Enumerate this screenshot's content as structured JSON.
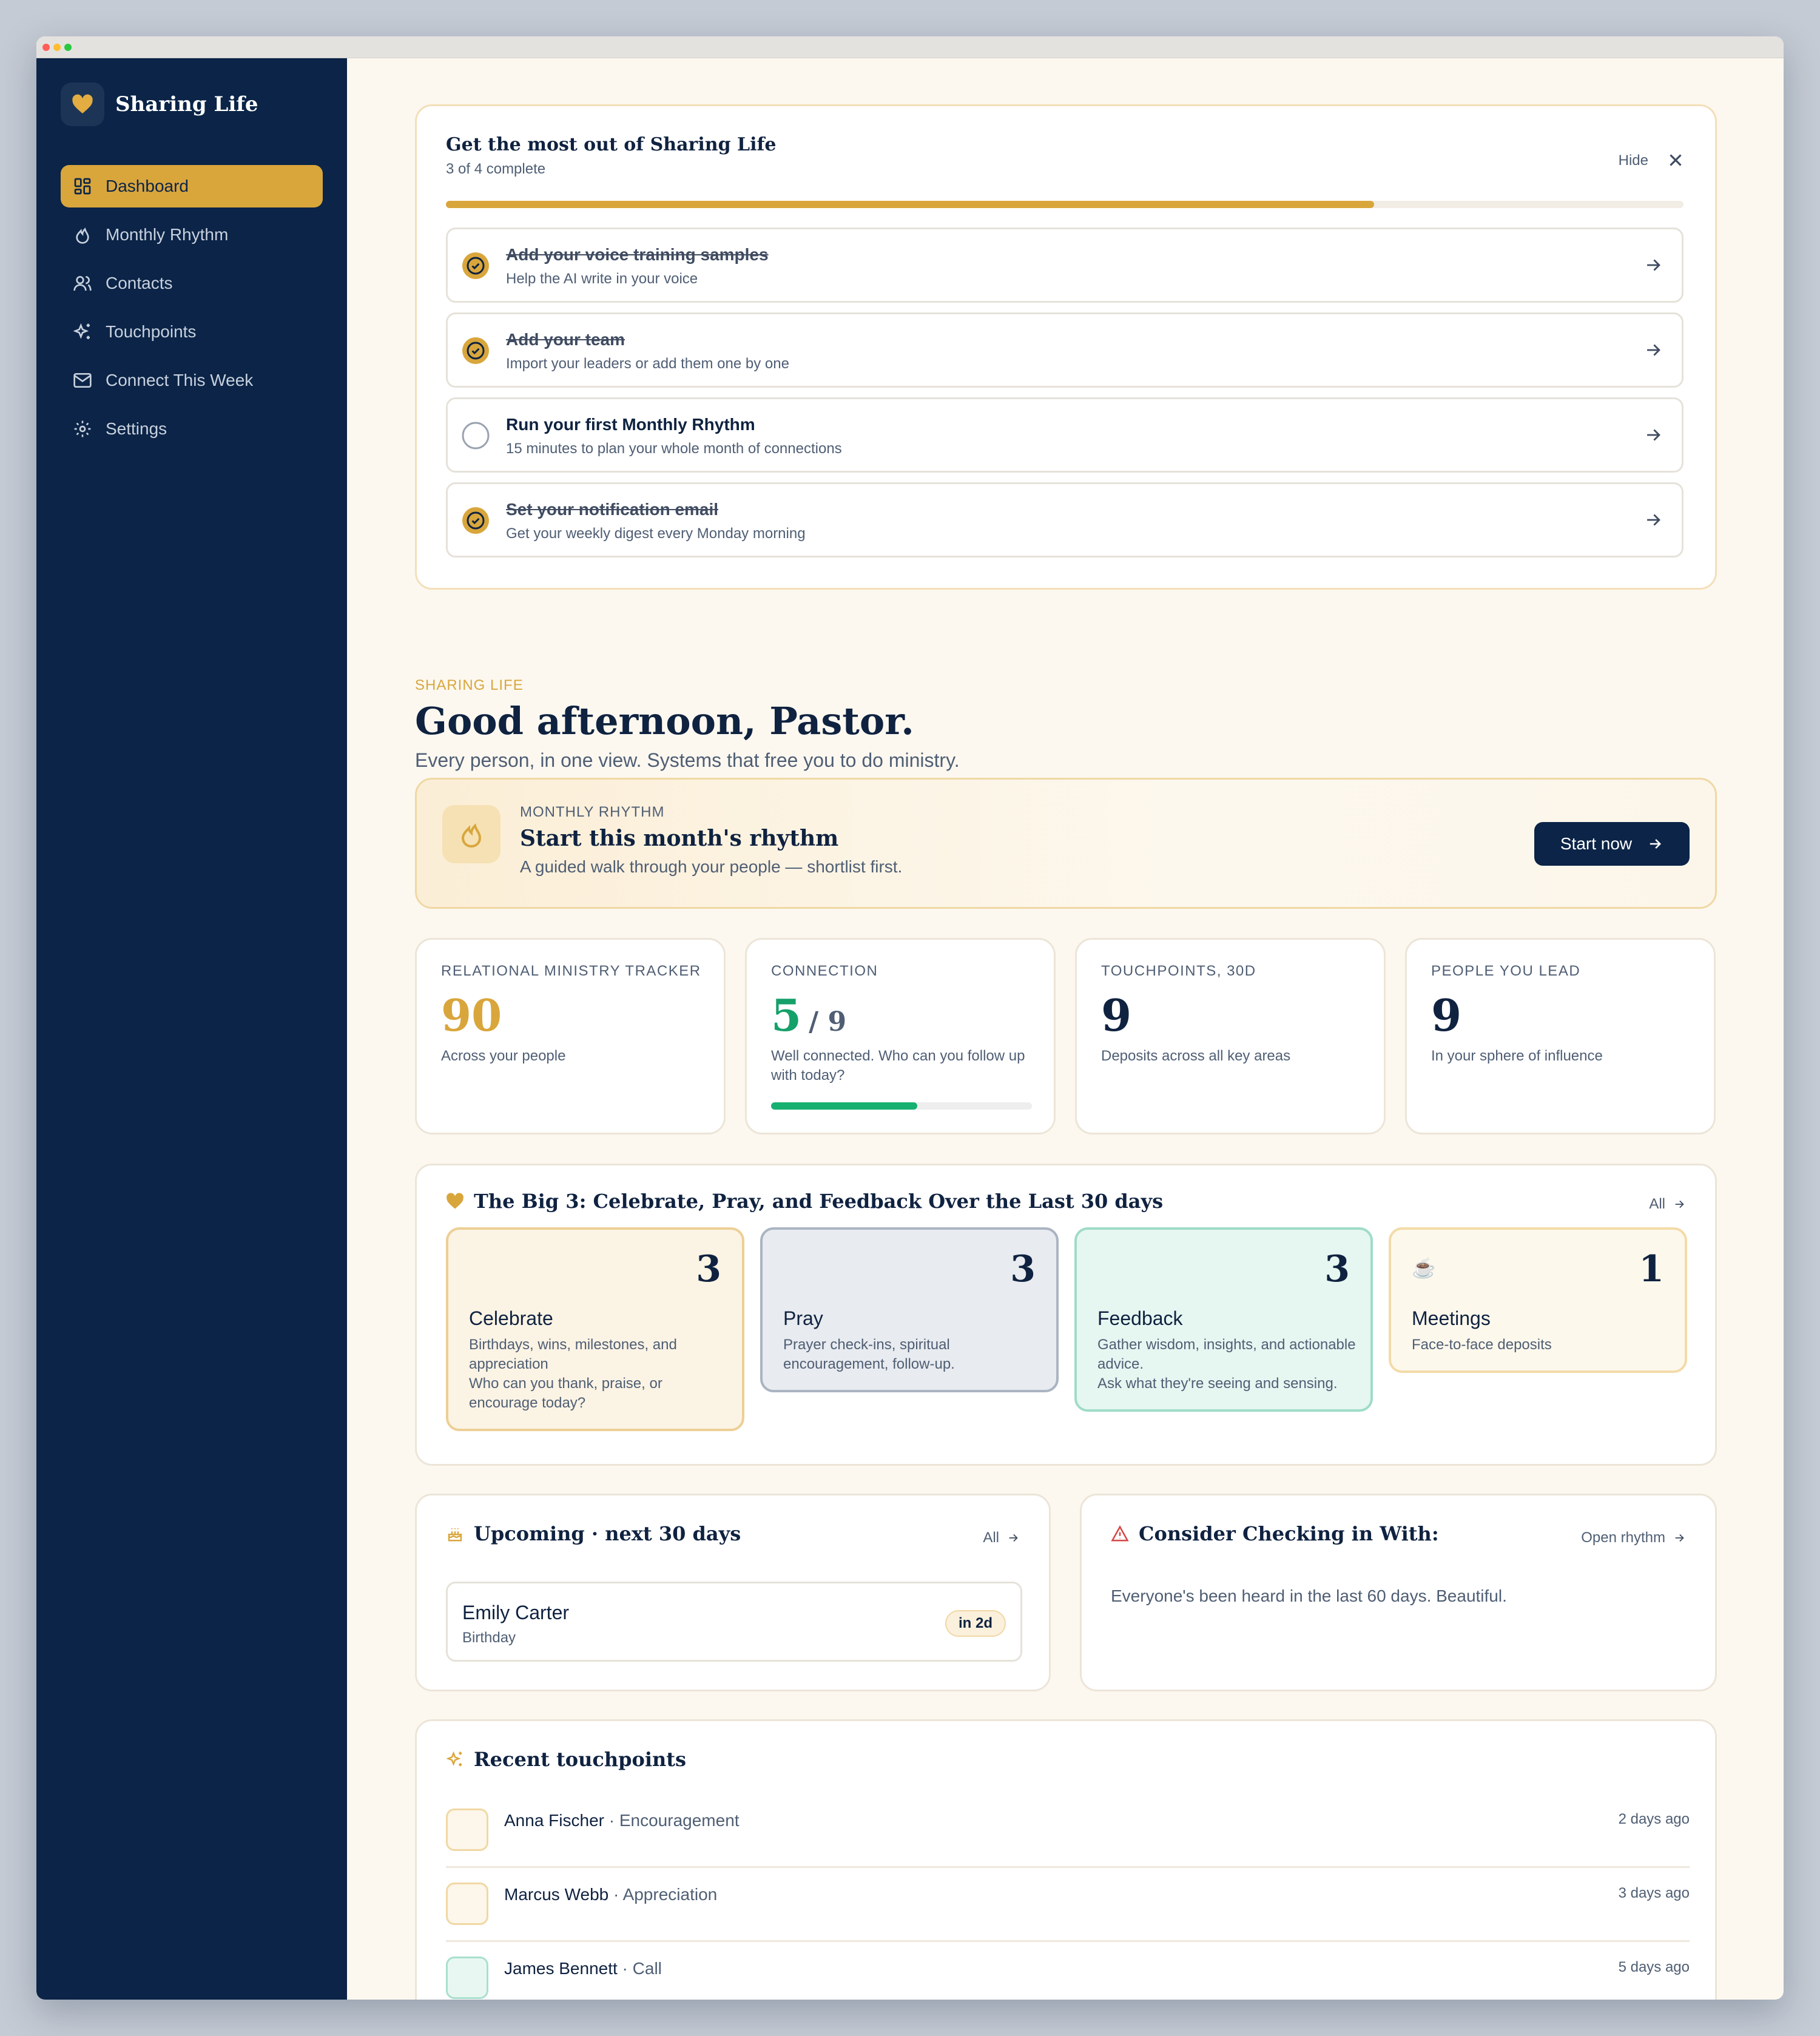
{
  "window": {
    "dots": [
      "#ff5f57",
      "#febc2e",
      "#28c840"
    ]
  },
  "brand": {
    "name": "Sharing Life",
    "logo_icon": "heart-icon"
  },
  "sidebar": {
    "items": [
      {
        "label": "Dashboard",
        "icon": "grid-icon",
        "active": true
      },
      {
        "label": "Monthly Rhythm",
        "icon": "flame-icon"
      },
      {
        "label": "Contacts",
        "icon": "users-icon"
      },
      {
        "label": "Touchpoints",
        "icon": "sparkles-icon"
      },
      {
        "label": "Connect This Week",
        "icon": "mail-icon"
      },
      {
        "label": "Settings",
        "icon": "gear-icon"
      }
    ]
  },
  "onboarding": {
    "title": "Get the most out of Sharing Life",
    "progress_text": "3 of 4 complete",
    "progress_fraction": 0.75,
    "hide_label": "Hide",
    "steps": [
      {
        "title": "Add your voice training samples",
        "desc": "Help the AI write in your voice",
        "done": true
      },
      {
        "title": "Add your team",
        "desc": "Import your leaders or add them one by one",
        "done": true
      },
      {
        "title": "Run your first Monthly Rhythm",
        "desc": "15 minutes to plan your whole month of connections",
        "done": false
      },
      {
        "title": "Set your notification email",
        "desc": "Get your weekly digest every Monday morning",
        "done": true
      }
    ]
  },
  "greeting": {
    "eyebrow": "SHARING LIFE",
    "title": "Good afternoon, Pastor.",
    "subtitle": "Every person, in one view. Systems that free you to do ministry."
  },
  "rhythm": {
    "eyebrow": "MONTHLY RHYTHM",
    "title": "Start this month's rhythm",
    "subtitle": "A guided walk through your people — shortlist first.",
    "button": "Start now"
  },
  "stats": [
    {
      "label": "RELATIONAL MINISTRY TRACKER",
      "value": "90",
      "desc": "Across your people",
      "color": "#d9a63c"
    },
    {
      "label": "CONNECTION",
      "value": "5",
      "denominator": "/ 9",
      "desc": "Well connected. Who can you follow up with today?",
      "color": "#16a06a",
      "progress_fraction": 0.56
    },
    {
      "label": "TOUCHPOINTS, 30D",
      "value": "9",
      "desc": "Deposits across all key areas",
      "color": "#0f2240"
    },
    {
      "label": "PEOPLE YOU LEAD",
      "value": "9",
      "desc": "In your sphere of influence",
      "color": "#0f2240"
    }
  ],
  "big3": {
    "title": "The Big 3: Celebrate, Pray, and Feedback Over the Last 30 days",
    "all_label": "All",
    "tiles": [
      {
        "name": "Celebrate",
        "count": "3",
        "icon": "",
        "desc": "Birthdays, wins, milestones, and appreciation\nWho can you thank, praise, or encourage today?",
        "bg": "#fbf3e4",
        "border": "#edcf95"
      },
      {
        "name": "Pray",
        "count": "3",
        "icon": "",
        "desc": "Prayer check-ins, spiritual encouragement, follow-up.",
        "bg": "#e8ebef",
        "border": "#aab4c2"
      },
      {
        "name": "Feedback",
        "count": "3",
        "icon": "",
        "desc": "Gather wisdom, insights, and actionable advice.\nAsk what they're seeing and sensing.",
        "bg": "#e6f6f1",
        "border": "#9fdcc6"
      },
      {
        "name": "Meetings",
        "count": "1",
        "icon": "☕",
        "desc": "Face-to-face deposits",
        "bg": "#fdf8ec",
        "border": "#f3dba8"
      }
    ]
  },
  "upcoming": {
    "title": "Upcoming · next 30 days",
    "all_label": "All",
    "items": [
      {
        "name": "Emily Carter",
        "type": "Birthday",
        "badge": "in 2d"
      }
    ]
  },
  "checkin": {
    "title": "Consider Checking in With:",
    "link": "Open rhythm",
    "message": "Everyone's been heard in the last 60 days. Beautiful."
  },
  "recent": {
    "title": "Recent touchpoints",
    "items": [
      {
        "name": "Anna Fischer",
        "sep": " · ",
        "type": "Encouragement",
        "time": "2 days ago",
        "icon": "",
        "bg": "#fdf6ea",
        "border": "#f0d8a4"
      },
      {
        "name": "Marcus Webb",
        "sep": " · ",
        "type": "Appreciation",
        "time": "3 days ago",
        "icon": "",
        "bg": "#fdf6ea",
        "border": "#f0d8a4"
      },
      {
        "name": "James Bennett",
        "sep": " · ",
        "type": "Call",
        "time": "5 days ago",
        "icon": "",
        "bg": "#e9f7f2",
        "border": "#a9e0cc"
      }
    ]
  }
}
